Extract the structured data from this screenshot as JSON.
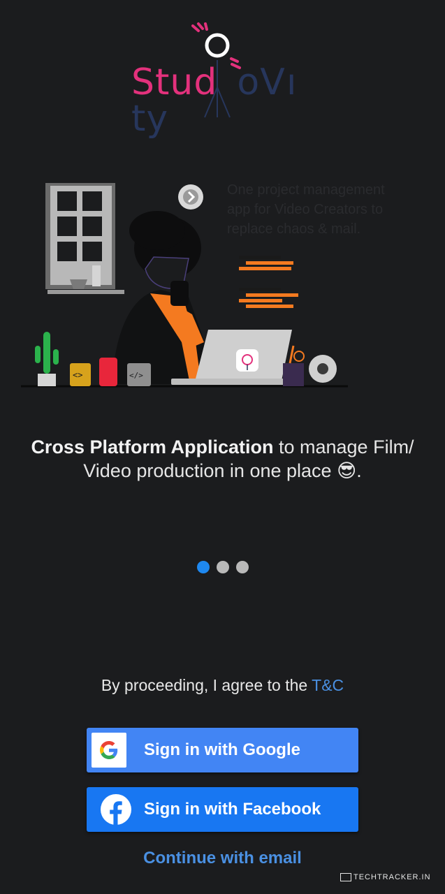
{
  "logo": {
    "part1": "Stud",
    "part2": "oV",
    "part3": "ty"
  },
  "illustration": {
    "caption": "One project management app for Video Creators to replace chaos & mail."
  },
  "tagline": {
    "bold": "Cross Platform Application",
    "rest": " to manage Film/ Video production in one place",
    "emoji": "😎",
    "end": "."
  },
  "pager": {
    "total": 3,
    "active_index": 0
  },
  "terms": {
    "text": "By proceeding, I agree to the ",
    "link": "T&C"
  },
  "buttons": {
    "google": "Sign in with Google",
    "facebook": "Sign in with Facebook",
    "email": "Continue with email"
  },
  "watermark": "TECHTRACKER.IN",
  "colors": {
    "background": "#1b1c1e",
    "google_blue": "#4285f4",
    "facebook_blue": "#1877f2",
    "link_blue": "#4a90e2",
    "brand_pink": "#e3317c",
    "brand_navy": "#27365c"
  }
}
